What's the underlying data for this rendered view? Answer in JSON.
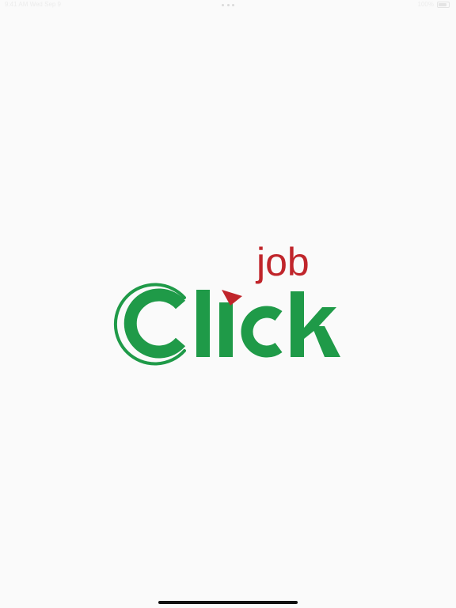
{
  "status_bar": {
    "left_text": "9:41 AM  Wed Sep 9",
    "right_text": "100%"
  },
  "logo": {
    "word_main": "Click",
    "word_small": "job",
    "colors": {
      "green": "#1f9a48",
      "red": "#c0252b"
    },
    "icon": "click-job-logo"
  }
}
